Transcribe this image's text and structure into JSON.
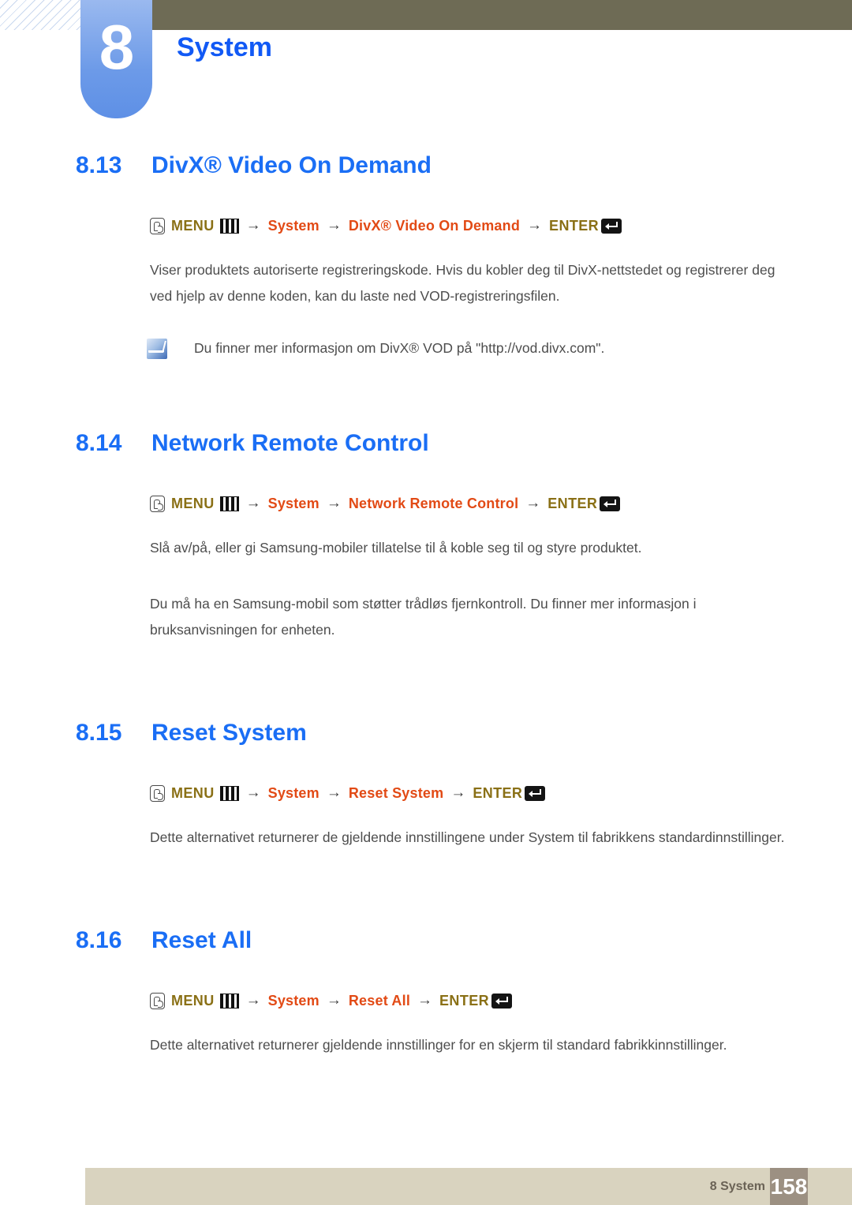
{
  "header": {
    "chapter_number": "8",
    "chapter_title": "System"
  },
  "icons": {
    "hand_press": "hand-press-icon",
    "menu_grid": "menu-grid-icon",
    "enter_key": "enter-key-icon",
    "note": "note-pen-icon"
  },
  "sections": [
    {
      "number": "8.13",
      "title": "DivX® Video On Demand",
      "menu_path": {
        "menu_label": "MENU",
        "arrow": "→",
        "items": [
          "System",
          "DivX® Video On Demand"
        ],
        "enter_label": "ENTER"
      },
      "paragraphs": [
        "Viser produktets autoriserte registreringskode. Hvis du kobler deg til DivX-nettstedet og registrerer deg ved hjelp av denne koden, kan du laste ned VOD-registreringsfilen."
      ],
      "note": "Du finner mer informasjon om DivX® VOD på \"http://vod.divx.com\"."
    },
    {
      "number": "8.14",
      "title": "Network Remote Control",
      "menu_path": {
        "menu_label": "MENU",
        "arrow": "→",
        "items": [
          "System",
          "Network Remote Control"
        ],
        "enter_label": "ENTER"
      },
      "paragraphs": [
        "Slå av/på, eller gi Samsung-mobiler tillatelse til å koble seg til og styre produktet.",
        "Du må ha en Samsung-mobil som støtter trådløs fjernkontroll. Du finner mer informasjon i bruksanvisningen for enheten."
      ]
    },
    {
      "number": "8.15",
      "title": "Reset System",
      "menu_path": {
        "menu_label": "MENU",
        "arrow": "→",
        "items": [
          "System",
          "Reset System"
        ],
        "enter_label": "ENTER"
      },
      "paragraphs": [
        "Dette alternativet returnerer de gjeldende innstillingene under System til fabrikkens standardinnstillinger."
      ]
    },
    {
      "number": "8.16",
      "title": "Reset All",
      "menu_path": {
        "menu_label": "MENU",
        "arrow": "→",
        "items": [
          "System",
          "Reset All"
        ],
        "enter_label": "ENTER"
      },
      "paragraphs": [
        "Dette alternativet returnerer gjeldende innstillinger for en skjerm til standard fabrikkinnstillinger."
      ]
    }
  ],
  "footer": {
    "label": "8 System",
    "page_number": "158"
  },
  "colors": {
    "heading_blue": "#1a6ef5",
    "menu_olive": "#8a7016",
    "path_orange": "#e24a15",
    "header_olive_bar": "#6e6b55",
    "tab_blue": "#6c9ae8",
    "footer_bar": "#d9d3bf",
    "footer_page_box": "#9c9082"
  }
}
